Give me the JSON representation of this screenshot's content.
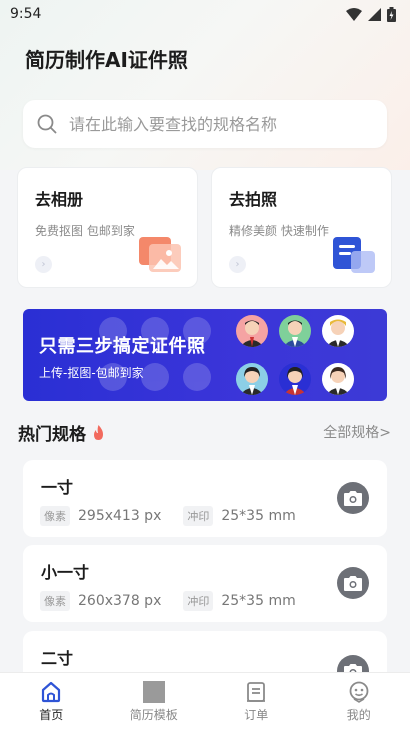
{
  "status": {
    "time": "9:54"
  },
  "header": {
    "title": "简历制作AI证件照"
  },
  "search": {
    "placeholder": "请在此输入要查找的规格名称"
  },
  "cards": [
    {
      "title": "去相册",
      "subtitle": "免费抠图 包邮到家"
    },
    {
      "title": "去拍照",
      "subtitle": "精修美颜 快速制作"
    }
  ],
  "banner": {
    "title": "只需三步搞定证件照",
    "subtitle": "上传-抠图-包邮到家"
  },
  "section": {
    "title": "热门规格",
    "link": "全部规格>"
  },
  "specs": [
    {
      "name": "一寸",
      "pixel_tag": "像素",
      "pixel": "295x413 px",
      "print_tag": "冲印",
      "print": "25*35 mm"
    },
    {
      "name": "小一寸",
      "pixel_tag": "像素",
      "pixel": "260x378 px",
      "print_tag": "冲印",
      "print": "25*35 mm"
    },
    {
      "name": "二寸"
    }
  ],
  "tabs": [
    {
      "label": "首页",
      "icon": "home-icon",
      "active": true
    },
    {
      "label": "简历模板",
      "icon": "resume-template-icon"
    },
    {
      "label": "订单",
      "icon": "order-icon"
    },
    {
      "label": "我的",
      "icon": "profile-icon"
    }
  ],
  "colors": {
    "banner": "#2f33d6",
    "accent": "#2f54d6",
    "camera": "#6d7077"
  }
}
